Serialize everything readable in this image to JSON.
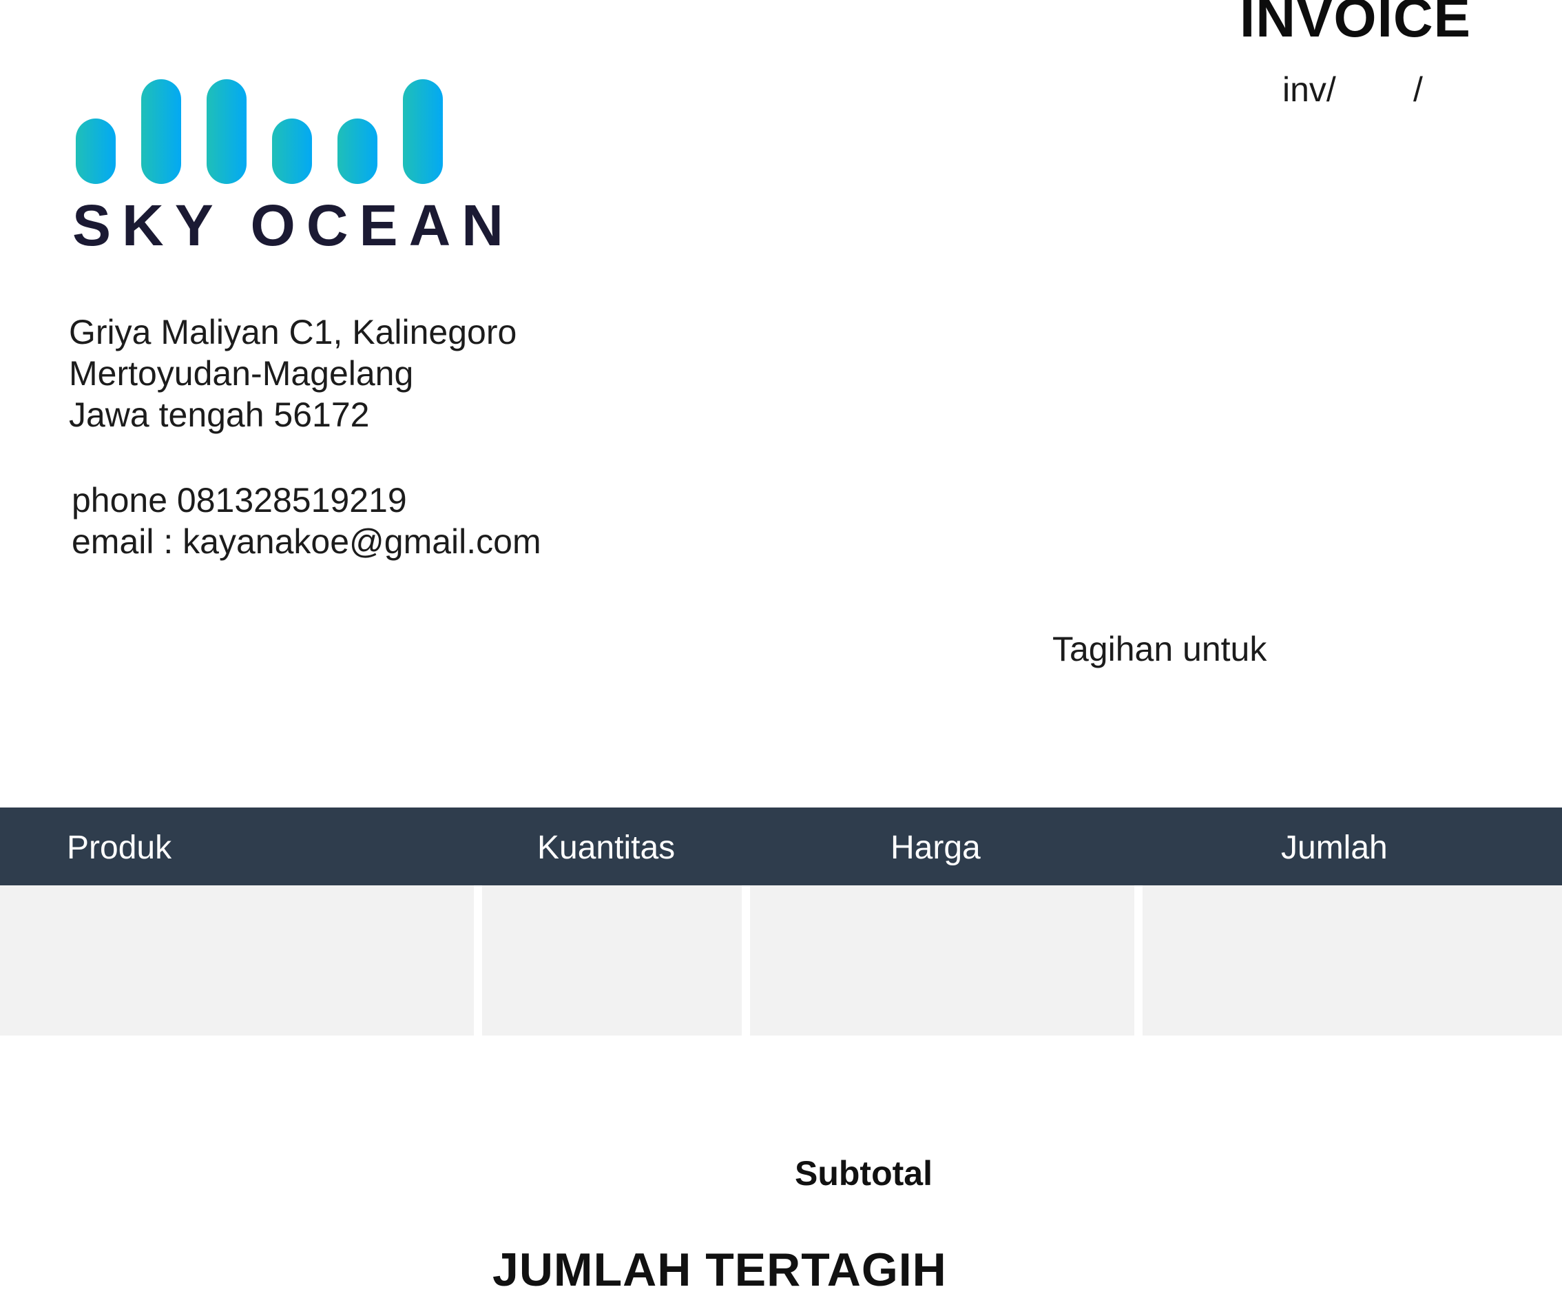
{
  "header": {
    "title": "INVOICE",
    "invoice_prefix": "inv/",
    "invoice_separator": "/"
  },
  "company": {
    "name": "SKY OCEAN",
    "logo_colors": [
      "#1fbfb8",
      "#03a9f4"
    ],
    "address_lines": [
      "Griya Maliyan C1, Kalinegoro",
      "Mertoyudan-Magelang",
      "Jawa tengah 56172"
    ],
    "phone": "phone 081328519219",
    "email": "email : kayanakoe@gmail.com"
  },
  "bill_to": {
    "label": "Tagihan untuk"
  },
  "table": {
    "header_color": "#2f3d4d",
    "columns": [
      "Produk",
      "Kuantitas",
      "Harga",
      "Jumlah"
    ]
  },
  "totals": {
    "subtotal_label": "Subtotal",
    "total_label": "JUMLAH TERTAGIH"
  }
}
